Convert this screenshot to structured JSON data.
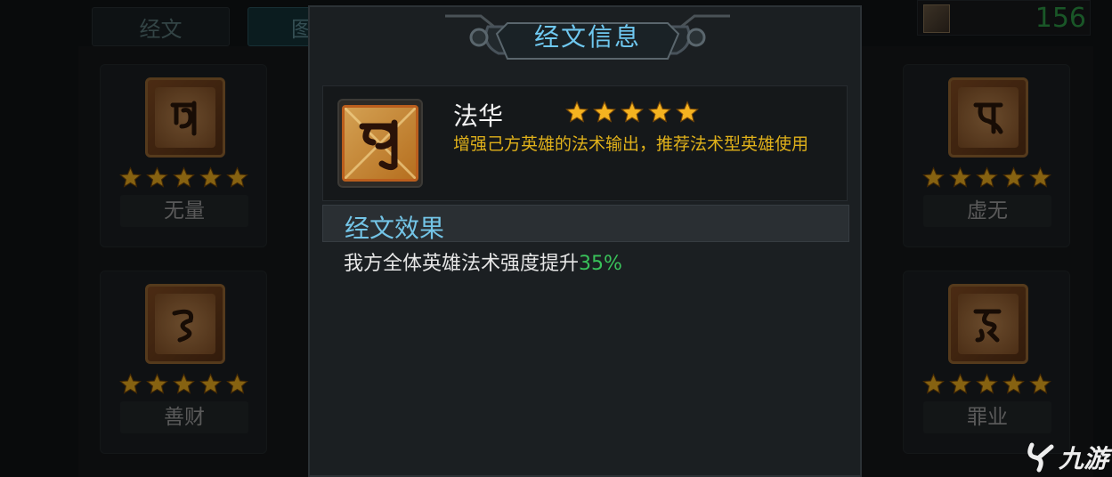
{
  "tabs": {
    "scripture": "经文",
    "graph_partial": "图"
  },
  "currency": {
    "icon": "scroll-icon",
    "value": "156"
  },
  "left_cards": [
    {
      "name": "无量",
      "stars": 5
    },
    {
      "name": "善财",
      "stars": 5
    }
  ],
  "right_cards": [
    {
      "name": "虚无",
      "stars": 5
    },
    {
      "name": "罪业",
      "stars": 5
    }
  ],
  "dialog": {
    "title": "经文信息",
    "item": {
      "name": "法华",
      "stars": 5,
      "description": "增强己方英雄的法术输出，推荐法术型英雄使用"
    },
    "effect_header": "经文效果",
    "effect_text": "我方全体英雄法术强度提升",
    "effect_value": "35%"
  },
  "watermark": {
    "text": "九游"
  },
  "colors": {
    "title_blue": "#6fc8f0",
    "desc_gold": "#e0b11a",
    "percent_green": "#39c25a",
    "star_gold": "#f5b320",
    "currency_green": "#2f9d47"
  }
}
